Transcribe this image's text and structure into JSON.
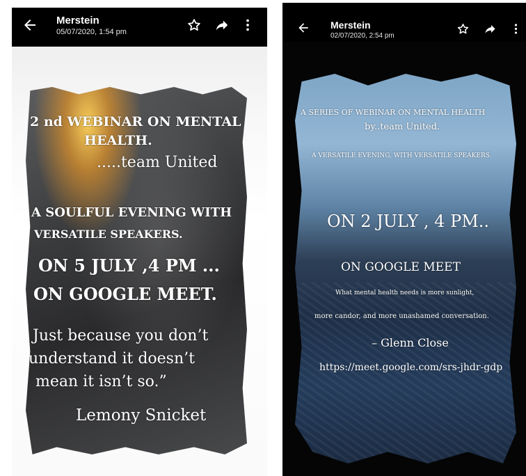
{
  "screens": [
    {
      "header": {
        "sender": "Merstein",
        "timestamp": "05/07/2020, 1:54 pm"
      },
      "icons": {
        "back": "arrow-back-icon",
        "star": "star-outline-icon",
        "share": "share-arrow-icon",
        "more": "more-vert-icon"
      },
      "poster": {
        "line1": "2 nd WEBINAR ON MENTAL",
        "line2": "HEALTH.",
        "line3": ".....team United",
        "line4": "A SOULFUL EVENING WITH",
        "line5": "VERSATILE SPEAKERS.",
        "line6": "ON 5 JULY ,4 PM ...",
        "line7": "ON GOOGLE MEET.",
        "quote1": "Just because you don’t",
        "quote2": "understand it doesn’t",
        "quote3": "mean it isn’t so.”",
        "author": "Lemony Snicket"
      }
    },
    {
      "header": {
        "sender": "Merstein",
        "timestamp": "02/07/2020, 2:54 pm"
      },
      "icons": {
        "back": "arrow-back-icon",
        "star": "star-outline-icon",
        "share": "share-arrow-icon",
        "more": "more-vert-icon"
      },
      "poster": {
        "line1": "A SERIES OF WEBINAR ON  MENTAL HEALTH",
        "line2": "by..team United.",
        "line3": "A VERSATILE EVENING, WITH VERSATILE SPEAKERS.",
        "line4": "ON 2 JULY , 4 PM..",
        "line5": "ON GOOGLE MEET",
        "line6": "What mental health needs is more sunlight,",
        "line7": "more candor, and more unashamed conversation.",
        "line8": "– Glenn Close",
        "line9": "https://meet.google.com/srs-jhdr-gdp"
      }
    }
  ]
}
